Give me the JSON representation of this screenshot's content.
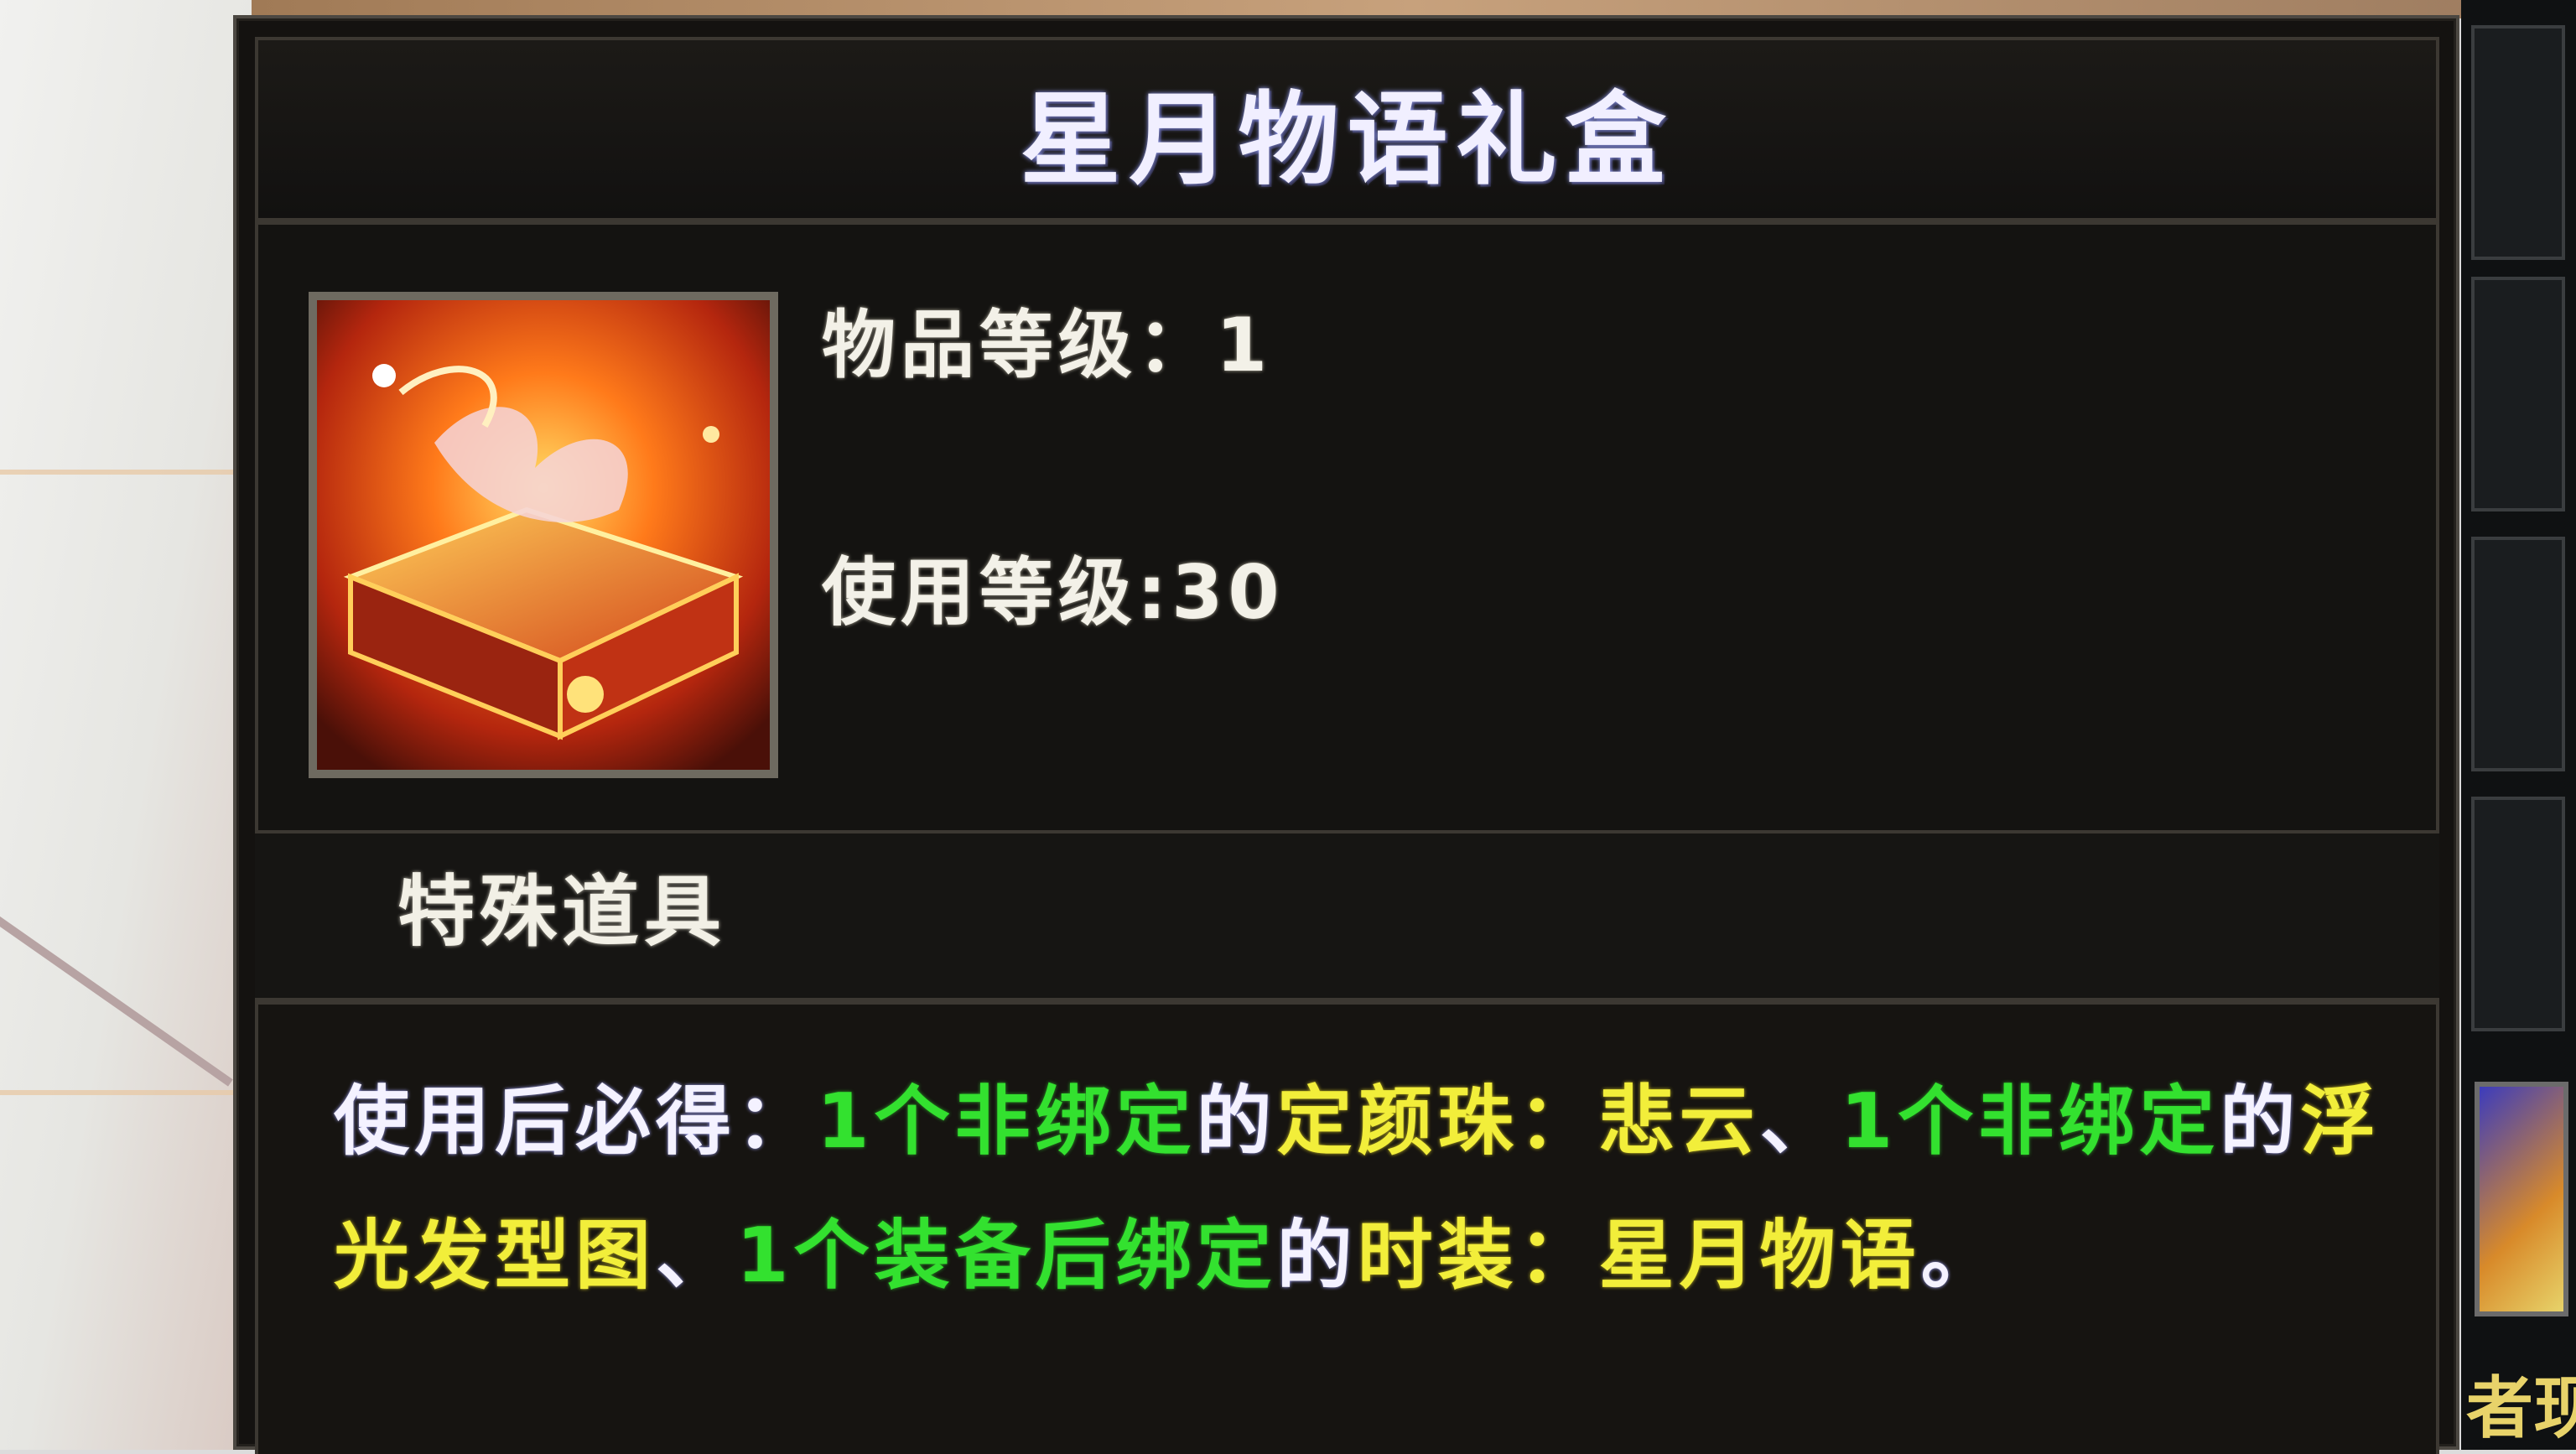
{
  "tooltip": {
    "title": "星月物语礼盒",
    "item_level_label": "物品等级：",
    "item_level_value": "1",
    "use_level_label": "使用等级:",
    "use_level_value": "30",
    "item_type": "特殊道具",
    "icon": "gift-box-icon",
    "description_segments": [
      {
        "text": "使用后必得：",
        "color": "white"
      },
      {
        "text": "1个非绑定",
        "color": "green"
      },
      {
        "text": "的",
        "color": "white"
      },
      {
        "text": "定颜珠：悲云",
        "color": "yellow"
      },
      {
        "text": "、",
        "color": "white"
      },
      {
        "text": "1个非绑定",
        "color": "green"
      },
      {
        "text": "的",
        "color": "white"
      },
      {
        "text": "浮光发型图",
        "color": "yellow"
      },
      {
        "text": "、",
        "color": "white"
      },
      {
        "text": "1个装备后绑定",
        "color": "green"
      },
      {
        "text": "的",
        "color": "white"
      },
      {
        "text": "时装：星月物语",
        "color": "yellow"
      },
      {
        "text": "。",
        "color": "white"
      }
    ]
  },
  "right_panel": {
    "partial_label": "者现"
  },
  "colors": {
    "white": "#f4f2ff",
    "green": "#33e12f",
    "yellow": "#f2ee3a",
    "panel_bg": "#141210",
    "border": "#4c4842"
  }
}
